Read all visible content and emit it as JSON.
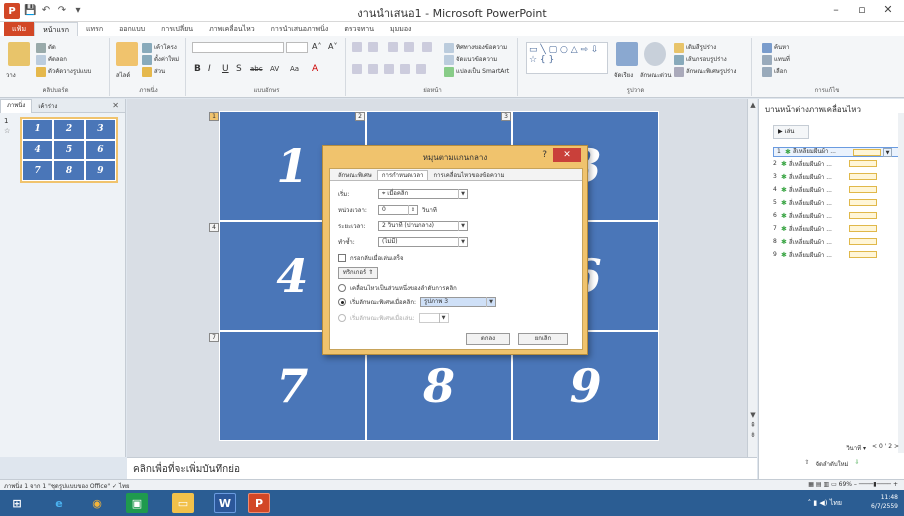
{
  "window": {
    "title": "งานนำเสนอ1 - Microsoft PowerPoint",
    "controls": [
      "–",
      "▫",
      "✕"
    ]
  },
  "qat": {
    "logo": "P",
    "buttons": [
      "💾",
      "↶",
      "↷",
      "▾"
    ]
  },
  "ribbon_tabs": [
    "แฟ้ม",
    "หน้าแรก",
    "แทรก",
    "ออกแบบ",
    "การเปลี่ยน",
    "ภาพเคลื่อนไหว",
    "การนำเสนอภาพนิ่ง",
    "ตรวจทาน",
    "มุมมอง"
  ],
  "ribbon": {
    "clipboard": {
      "paste": "วาง",
      "cut": "ตัด",
      "copy": "คัดลอก",
      "format": "ตัวคัดวางรูปแบบ",
      "label": "คลิปบอร์ด"
    },
    "slides": {
      "new": "สไลด์",
      "layout": "เค้าโครง",
      "reset": "ตั้งค่าใหม่",
      "section": "ส่วน",
      "label": "ภาพนิ่ง"
    },
    "font": {
      "label": "แบบอักษร",
      "bold": "B",
      "italic": "I",
      "underline": "U",
      "shadow": "S",
      "strike": "abc",
      "spacing": "AV",
      "case": "Aa",
      "color": "A",
      "size_up": "A˄",
      "size_down": "A˅"
    },
    "paragraph": {
      "label": "ย่อหน้า",
      "direction": "ทิศทางของข้อความ",
      "align": "จัดแนวข้อความ",
      "smartart": "แปลงเป็น SmartArt"
    },
    "drawing": {
      "label": "รูปวาด",
      "arrange": "จัดเรียง",
      "quick": "ลักษณะด่วน",
      "fill": "เติมสีรูปร่าง",
      "outline": "เส้นกรอบรูปร่าง",
      "effects": "ลักษณะพิเศษรูปร่าง"
    },
    "editing": {
      "label": "การแก้ไข",
      "find": "ค้นหา",
      "replace": "แทนที่",
      "select": "เลือก"
    }
  },
  "left_pane": {
    "tabs": [
      "ภาพนิ่ง",
      "เค้าร่าง"
    ],
    "close": "✕",
    "slide_number": "1",
    "star": "☆"
  },
  "slide": {
    "cells": [
      "1",
      "2",
      "3",
      "4",
      "5",
      "6",
      "7",
      "8",
      "9"
    ],
    "markers": [
      "1",
      "2",
      "3",
      "4",
      "7"
    ]
  },
  "notes": {
    "placeholder": "คลิกเพื่อที่จะเพิ่มบันทึกย่อ"
  },
  "anim_pane": {
    "title": "บานหน้าต่างภาพเคลื่อนไหว",
    "play": "▶ เล่น",
    "items": [
      {
        "num": "1",
        "label": "สี่เหลี่ยมผืนผ้า ..."
      },
      {
        "num": "2",
        "label": "สี่เหลี่ยมผืนผ้า ..."
      },
      {
        "num": "3",
        "label": "สี่เหลี่ยมผืนผ้า ..."
      },
      {
        "num": "4",
        "label": "สี่เหลี่ยมผืนผ้า ..."
      },
      {
        "num": "5",
        "label": "สี่เหลี่ยมผืนผ้า ..."
      },
      {
        "num": "6",
        "label": "สี่เหลี่ยมผืนผ้า ..."
      },
      {
        "num": "7",
        "label": "สี่เหลี่ยมผืนผ้า ..."
      },
      {
        "num": "8",
        "label": "สี่เหลี่ยมผืนผ้า ..."
      },
      {
        "num": "9",
        "label": "สี่เหลี่ยมผืนผ้า ..."
      }
    ],
    "seconds_label": "วินาที ▾",
    "timeline": "< 0 ' 2 >",
    "reorder": "จัดลำดับใหม่"
  },
  "status": {
    "left": "ภาพนิ่ง 1 จาก 1   \"ชุดรูปแบบของ Office\"   ✓   ไทย",
    "zoom": "69%",
    "zoom_minus": "–",
    "zoom_plus": "+"
  },
  "taskbar": {
    "time": "11:48",
    "date": "6/7/2559",
    "lang": "ไทย"
  },
  "dialog": {
    "title": "หมุนตามแกนกลาง",
    "help": "?",
    "close": "✕",
    "tabs": [
      "ลักษณะพิเศษ",
      "การกำหนดเวลา",
      "การเคลื่อนไหวของข้อความ"
    ],
    "start_label": "เริ่ม:",
    "start_value": "เมื่อคลิก",
    "delay_label": "หน่วงเวลา:",
    "delay_value": "0",
    "delay_unit": "วินาที",
    "duration_label": "ระยะเวลา:",
    "duration_value": "2 วินาที (ปานกลาง)",
    "repeat_label": "ทำซ้ำ:",
    "repeat_value": "(ไม่มี)",
    "rewind_label": "กรอกลับเมื่อเล่นเสร็จ",
    "triggers_label": "ทริกเกอร์ ⇑",
    "opt1": "เคลื่อนไหวเป็นส่วนหนึ่งของลำดับการคลิก",
    "opt2": "เริ่มลักษณะพิเศษเมื่อคลิก:",
    "opt2_value": "รูปภาพ 3",
    "opt3": "เริ่มลักษณะพิเศษเมื่อเล่น:",
    "ok": "ตกลง",
    "cancel": "ยกเลิก"
  },
  "colors": {
    "slide_blue": "#4a76b8",
    "dialog_frame": "#f0c36d",
    "ppt_orange": "#d24726",
    "taskbar": "#2b5d93"
  }
}
